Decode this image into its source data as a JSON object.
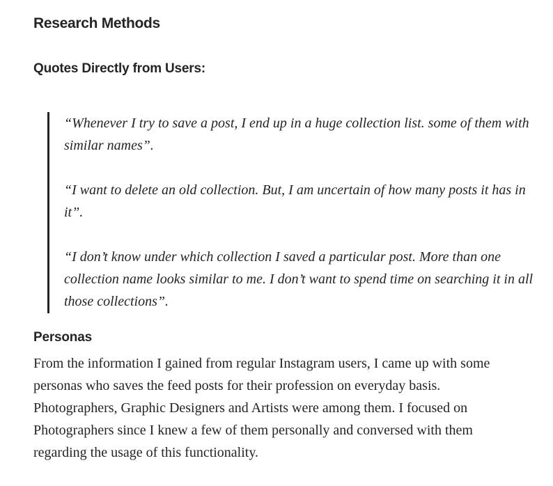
{
  "section_title": "Research Methods",
  "quotes_heading": "Quotes Directly from Users:",
  "quotes": [
    "“Whenever I try to save a post, I end up in a huge collection list. some of them with similar names”.",
    "“I want to delete an old collection. But, I am uncertain of how many posts it has in it”.",
    "“I don’t know under which collection I saved a particular post. More than one collection name looks similar to me. I don’t want to spend time on searching it in all those collections”."
  ],
  "personas_heading": "Personas",
  "personas_text": "From the information I gained from regular Instagram users, I came up with some personas who saves the feed posts for their profession on everyday basis. Photographers, Graphic Designers and Artists were among them. I focused on Photographers since I knew a few of them personally and conversed with them regarding the usage of this functionality."
}
